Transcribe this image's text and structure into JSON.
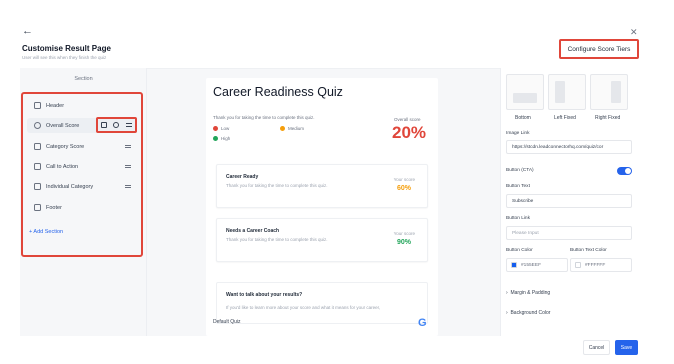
{
  "header": {
    "back_icon": "arrow-left-icon",
    "close_icon": "close-icon",
    "title": "Customise Result Page",
    "subtitle": "User will see this when they finish the quiz",
    "configure_tiers_label": "Configure Score Tiers"
  },
  "sections": {
    "heading": "Section",
    "items": [
      {
        "label": "Header",
        "icon": "header-icon"
      },
      {
        "label": "Overall Score",
        "icon": "score-icon"
      },
      {
        "label": "Category Score",
        "icon": "category-icon"
      },
      {
        "label": "Call to Action",
        "icon": "cta-icon"
      },
      {
        "label": "Individual Category",
        "icon": "individual-icon"
      },
      {
        "label": "Footer",
        "icon": "footer-icon"
      }
    ],
    "add_label": "+ Add Section"
  },
  "preview": {
    "quiz_title": "Career Readiness Quiz",
    "thanks_text": "Thank you for taking the time to complete this quiz.",
    "legend": [
      {
        "label": "Low",
        "color": "#e0463a"
      },
      {
        "label": "Medium",
        "color": "#f59e0b"
      },
      {
        "label": "High",
        "color": "#22a55a"
      }
    ],
    "overall_label": "Overall score",
    "overall_value": "20%",
    "tiers": [
      {
        "name": "Career Ready",
        "desc": "Thank you for taking the time to complete this quiz.",
        "your_score_label": "Your score",
        "score": "60%",
        "color": "#f59e0b"
      },
      {
        "name": "Needs a Career Coach",
        "desc": "Thank you for taking the time to complete this quiz.",
        "your_score_label": "Your score",
        "score": "90%",
        "color": "#22a55a"
      }
    ],
    "talk_title": "Want to talk about your results?",
    "talk_desc": "If you'd like to learn more about your score and what it means for your career,",
    "footer_text": "Default Quiz",
    "footer_logo": "G"
  },
  "settings": {
    "layouts": [
      {
        "label": "Bottom"
      },
      {
        "label": "Left Fixed"
      },
      {
        "label": "Right Fixed"
      }
    ],
    "image_link_label": "Image Link",
    "image_link_value": "https://stcdn.leadconnectorhq.com/quiz/cor",
    "button_cta_label": "Button (CTA)",
    "button_text_label": "Button Text",
    "button_text_value": "Subscribe",
    "button_link_label": "Button Link",
    "button_link_placeholder": "Please Input",
    "button_color_label": "Button Color",
    "button_color_value": "#155EEF",
    "button_text_color_label": "Button Text Color",
    "button_text_color_value": "#FFFFFF",
    "margin_padding": "Margin & Padding",
    "background_color": "Background Color"
  },
  "actions": {
    "cancel": "Cancel",
    "save": "Save"
  }
}
